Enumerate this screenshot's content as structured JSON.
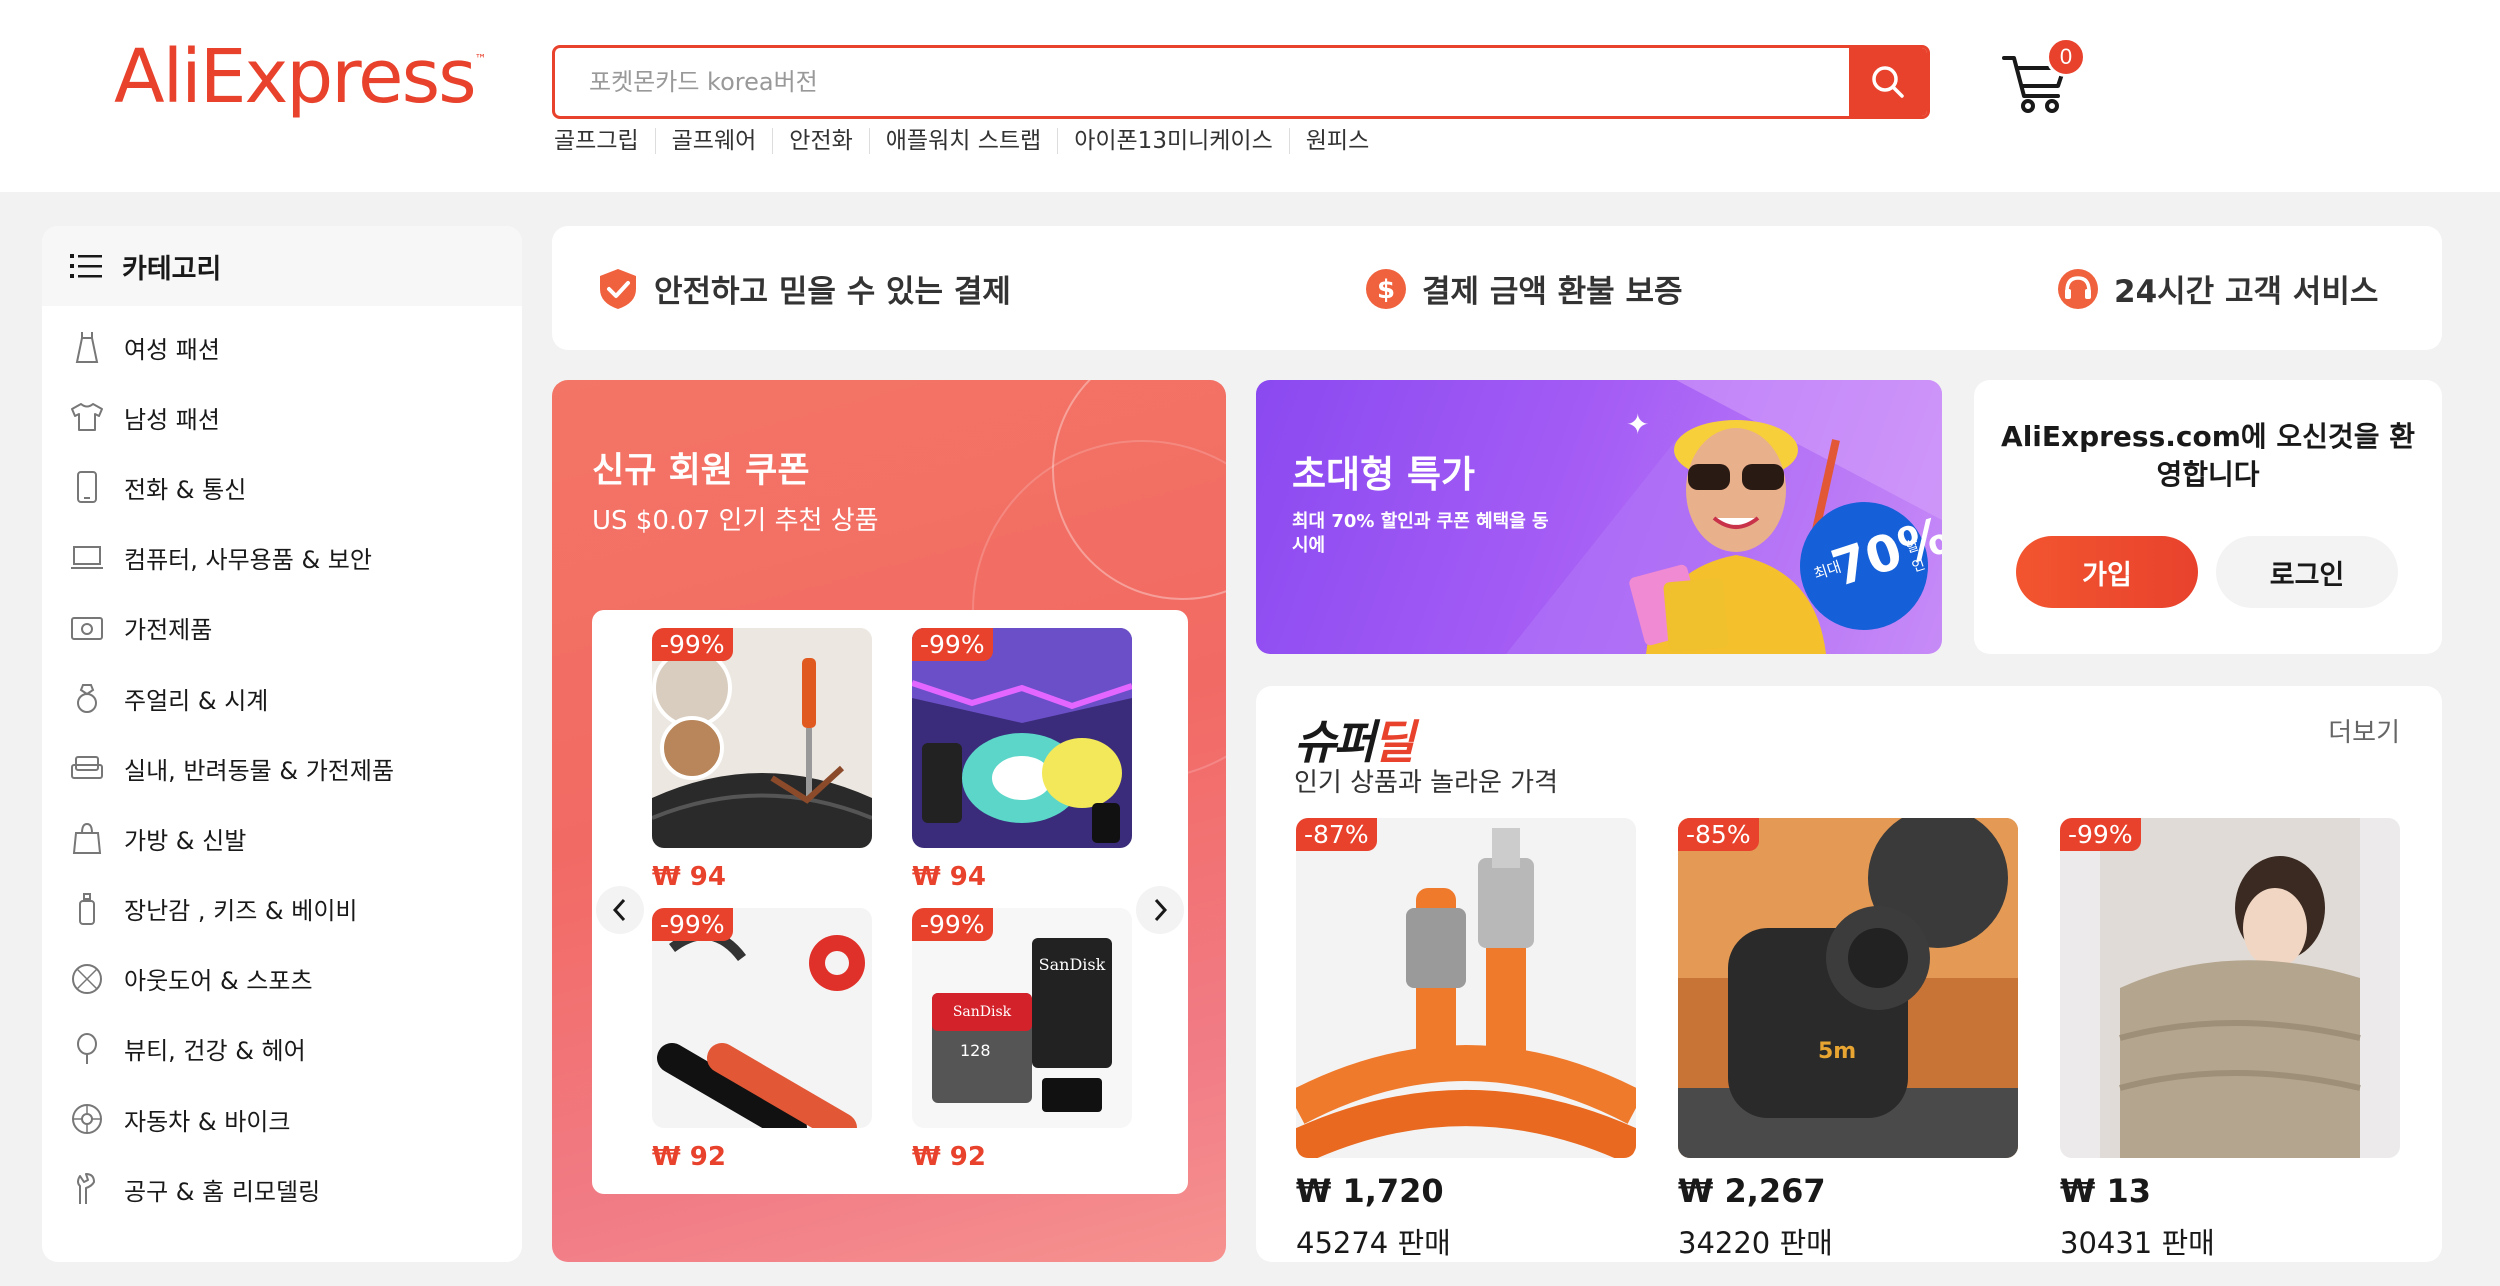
{
  "header": {
    "logo": "AliExpress",
    "search_placeholder": "포켓몬카드 korea버전",
    "hot_keywords": [
      "골프그립",
      "골프웨어",
      "안전화",
      "애플워치 스트랩",
      "아이폰13미니케이스",
      "원피스"
    ],
    "cart_count": "0"
  },
  "sidebar": {
    "title": "카테고리",
    "items": [
      {
        "label": "여성 패션",
        "icon": "dress-icon"
      },
      {
        "label": "남성 패션",
        "icon": "shirt-icon"
      },
      {
        "label": "전화 & 통신",
        "icon": "phone-icon"
      },
      {
        "label": "컴퓨터, 사무용품 & 보안",
        "icon": "laptop-icon"
      },
      {
        "label": "가전제품",
        "icon": "camera-icon"
      },
      {
        "label": "주얼리 & 시계",
        "icon": "ring-icon"
      },
      {
        "label": "실내, 반려동물 & 가전제품",
        "icon": "sofa-icon"
      },
      {
        "label": "가방 & 신발",
        "icon": "bag-icon"
      },
      {
        "label": "장난감 , 키즈 & 베이비",
        "icon": "bottle-icon"
      },
      {
        "label": "아웃도어 & 스포츠",
        "icon": "ball-icon"
      },
      {
        "label": "뷰티, 건강 & 헤어",
        "icon": "mirror-icon"
      },
      {
        "label": "자동차 & 바이크",
        "icon": "wheel-icon"
      },
      {
        "label": "공구 & 홈 리모델링",
        "icon": "tool-icon"
      }
    ]
  },
  "trust": {
    "items": [
      {
        "label": "안전하고 믿을 수 있는 결제",
        "icon": "shield-check-icon"
      },
      {
        "label": "결제 금액 환불 보증",
        "icon": "dollar-coin-icon"
      },
      {
        "label": "24시간 고객 서비스",
        "icon": "headset-icon"
      }
    ]
  },
  "coupon": {
    "title": "신규 회원 쿠폰",
    "subtitle": "US $0.07 인기 추천 상품",
    "products": [
      {
        "discount": "-99%",
        "price": "₩ 94"
      },
      {
        "discount": "-99%",
        "price": "₩ 94"
      },
      {
        "discount": "-99%",
        "price": "₩ 92"
      },
      {
        "discount": "-99%",
        "price": "₩ 92"
      }
    ]
  },
  "mega": {
    "title": "초대형 특가",
    "subtitle": "최대 70% 할인과 쿠폰 혜택을 동시에",
    "badge_top": "최대",
    "badge_value": "70%",
    "badge_bottom": "할인"
  },
  "welcome": {
    "title": "AliExpress.com에 오신것을 환영합니다",
    "join": "가입",
    "login": "로그인"
  },
  "superdeal": {
    "title_black": "슈퍼",
    "title_red": "딜",
    "subtitle": "인기 상품과 놀라운 가격",
    "more": "더보기",
    "products": [
      {
        "discount": "-87%",
        "price": "₩ 1,720",
        "sold": "45274 판매"
      },
      {
        "discount": "-85%",
        "price": "₩ 2,267",
        "sold": "34220 판매"
      },
      {
        "discount": "-99%",
        "price": "₩ 13",
        "sold": "30431 판매"
      }
    ]
  },
  "colors": {
    "brand": "#e8422d",
    "background": "#f2f2f2",
    "mega_purple": "#8a49f0"
  }
}
